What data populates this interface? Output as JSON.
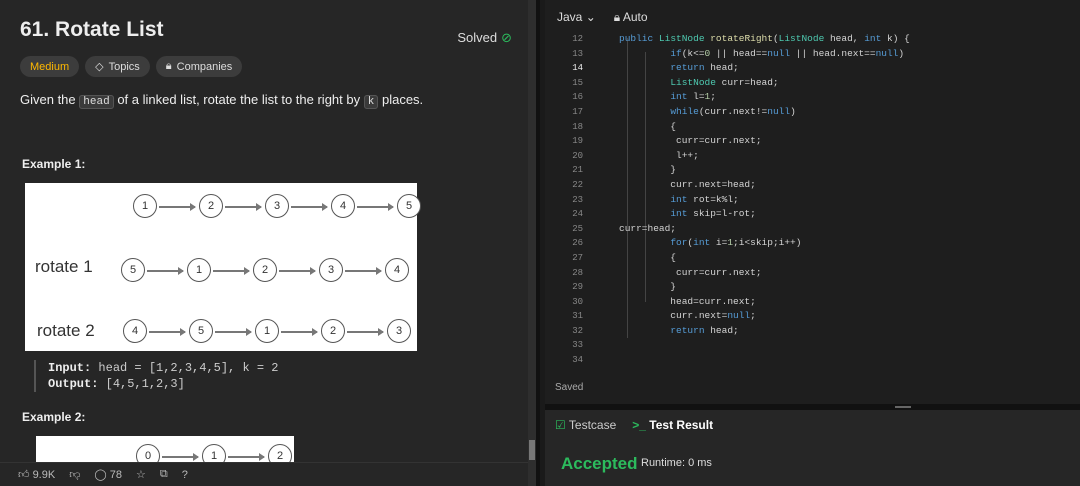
{
  "problem": {
    "title": "61. Rotate List",
    "status": "Solved",
    "difficulty": "Medium",
    "topics_label": "Topics",
    "companies_label": "Companies",
    "desc_pre": "Given the",
    "desc_head": "head",
    "desc_mid": "of a linked list, rotate the list to the right by",
    "desc_k": "k",
    "desc_post": "places."
  },
  "example1": {
    "title": "Example 1:",
    "original": [
      "1",
      "2",
      "3",
      "4",
      "5"
    ],
    "rotate1_label": "rotate 1",
    "rotate1": [
      "5",
      "1",
      "2",
      "3",
      "4"
    ],
    "rotate2_label": "rotate 2",
    "rotate2": [
      "4",
      "5",
      "1",
      "2",
      "3"
    ],
    "input_label": "Input:",
    "input_value": "head = [1,2,3,4,5], k = 2",
    "output_label": "Output:",
    "output_value": "[4,5,1,2,3]"
  },
  "example2": {
    "title": "Example 2:",
    "nodes": [
      "0",
      "1",
      "2"
    ]
  },
  "bottom_bar": {
    "likes": "9.9K",
    "comments": "78"
  },
  "editor": {
    "language": "Java",
    "mode": "Auto",
    "line_numbers": [
      "12",
      "13",
      "14",
      "15",
      "16",
      "17",
      "18",
      "19",
      "20",
      "21",
      "22",
      "23",
      "24",
      "25",
      "26",
      "27",
      "28",
      "29",
      "30",
      "31",
      "32",
      "33",
      "34"
    ],
    "active_line": "14",
    "saved_label": "Saved"
  },
  "result": {
    "testcase_tab": "Testcase",
    "result_tab": "Test Result",
    "verdict": "Accepted",
    "runtime": "Runtime: 0 ms"
  },
  "colors": {
    "accepted": "#2cbb5d",
    "medium": "#ffb800",
    "keyword": "#569cd6"
  }
}
